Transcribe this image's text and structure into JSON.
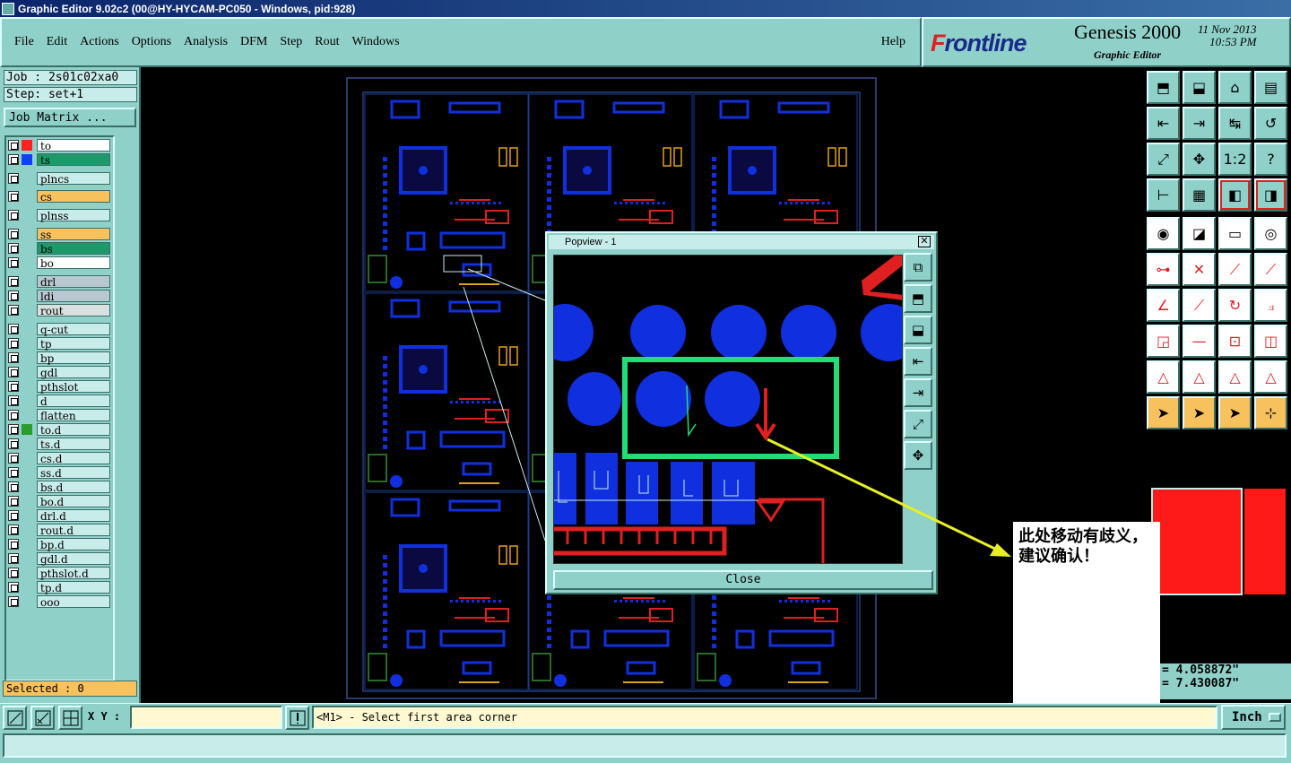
{
  "window": {
    "title": "Graphic Editor 9.02c2 (00@HY-HYCAM-PC050 - Windows, pid:928)"
  },
  "menu": {
    "items": [
      "File",
      "Edit",
      "Actions",
      "Options",
      "Analysis",
      "DFM",
      "Step",
      "Rout",
      "Windows"
    ],
    "help": "Help"
  },
  "brand": {
    "logo_f": "F",
    "logo_rest": "rontline",
    "product": "Genesis 2000",
    "subtitle": "Graphic Editor",
    "date": "11 Nov 2013",
    "time": "10:53 PM"
  },
  "job": {
    "job_label": "Job : 2s01c02xa0",
    "step_label": "Step: set+1",
    "matrix_button": "Job Matrix ..."
  },
  "layers": [
    {
      "name": "to",
      "color": "#ffffff",
      "swatch": "#ff2020",
      "active": true
    },
    {
      "name": "ts",
      "color": "#1e9a6a",
      "swatch": "#1040ff"
    },
    {
      "name": "plncs",
      "color": "#c8ecea",
      "swatch": ""
    },
    {
      "name": "cs",
      "color": "#f7c15d",
      "swatch": ""
    },
    {
      "name": "plnss",
      "color": "#c8ecea",
      "swatch": ""
    },
    {
      "name": "ss",
      "color": "#f7c15d",
      "swatch": ""
    },
    {
      "name": "bs",
      "color": "#1e9a6a",
      "swatch": ""
    },
    {
      "name": "bo",
      "color": "#ffffff",
      "swatch": ""
    },
    {
      "name": "drl",
      "color": "#b8c8d0",
      "swatch": ""
    },
    {
      "name": "ldi",
      "color": "#b8c8d0",
      "swatch": ""
    },
    {
      "name": "rout",
      "color": "#d8e0e0",
      "swatch": ""
    },
    {
      "name": "q-cut",
      "color": "#c8ecea",
      "swatch": ""
    },
    {
      "name": "tp",
      "color": "#c8ecea",
      "swatch": ""
    },
    {
      "name": "bp",
      "color": "#c8ecea",
      "swatch": ""
    },
    {
      "name": "gdl",
      "color": "#c8ecea",
      "swatch": ""
    },
    {
      "name": "pthslot",
      "color": "#c8ecea",
      "swatch": ""
    },
    {
      "name": "d",
      "color": "#c8ecea",
      "swatch": ""
    },
    {
      "name": "flatten",
      "color": "#c8ecea",
      "swatch": ""
    },
    {
      "name": "to.d",
      "color": "#c8ecea",
      "swatch": "#2c9a2c"
    },
    {
      "name": "ts.d",
      "color": "#c8ecea",
      "swatch": ""
    },
    {
      "name": "cs.d",
      "color": "#c8ecea",
      "swatch": ""
    },
    {
      "name": "ss.d",
      "color": "#c8ecea",
      "swatch": ""
    },
    {
      "name": "bs.d",
      "color": "#c8ecea",
      "swatch": ""
    },
    {
      "name": "bo.d",
      "color": "#c8ecea",
      "swatch": ""
    },
    {
      "name": "drl.d",
      "color": "#c8ecea",
      "swatch": ""
    },
    {
      "name": "rout.d",
      "color": "#c8ecea",
      "swatch": ""
    },
    {
      "name": "bp.d",
      "color": "#c8ecea",
      "swatch": ""
    },
    {
      "name": "gdl.d",
      "color": "#c8ecea",
      "swatch": ""
    },
    {
      "name": "pthslot.d",
      "color": "#c8ecea",
      "swatch": ""
    },
    {
      "name": "tp.d",
      "color": "#c8ecea",
      "swatch": ""
    },
    {
      "name": "ooo",
      "color": "#c8ecea",
      "swatch": ""
    }
  ],
  "selected": "Selected : 0",
  "popup": {
    "title": "Popview - 1",
    "close": "Close"
  },
  "note": "此处移动有歧义，建议确认！",
  "coords": {
    "x": "= 4.058872\"",
    "y": "= 7.430087\""
  },
  "status": {
    "xy_label": "X Y :",
    "xy_value": "",
    "message": "<M1> - Select first area corner",
    "unit": "Inch"
  },
  "colors": {
    "accent": "#8fd0c8",
    "signal": "#1030e0",
    "silk": "#e02020",
    "highlight": "#22dd77"
  }
}
